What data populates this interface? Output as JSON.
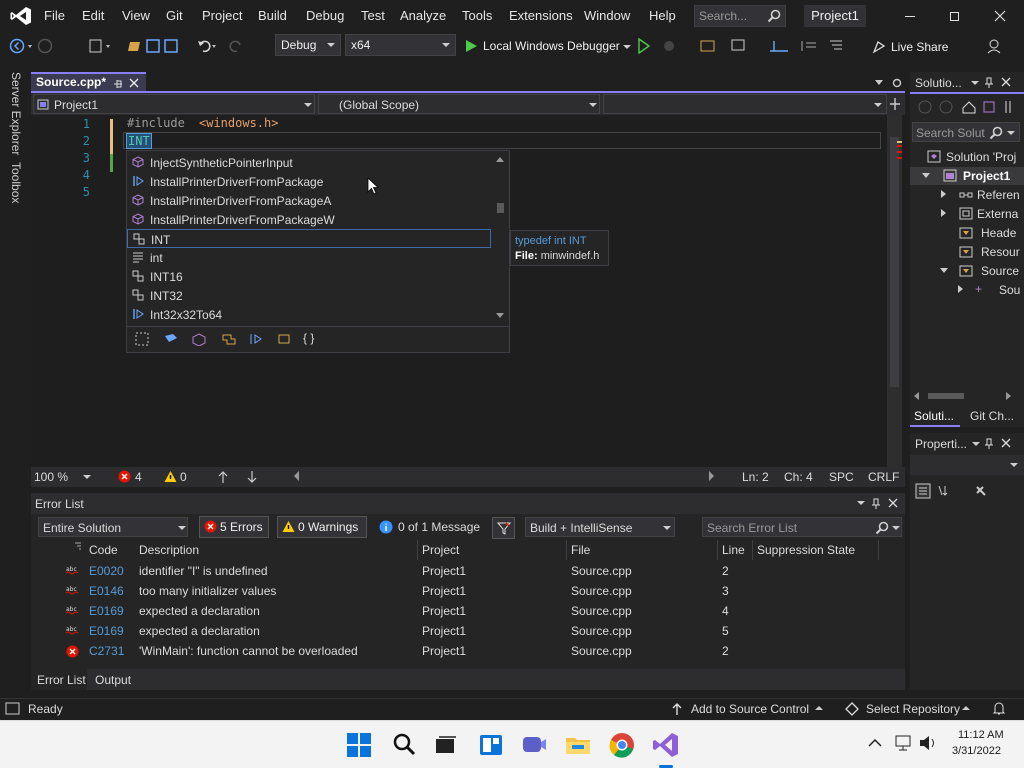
{
  "menu": {
    "items": [
      "File",
      "Edit",
      "View",
      "Git",
      "Project",
      "Build",
      "Debug",
      "Test",
      "Analyze",
      "Tools",
      "Extensions",
      "Window",
      "Help"
    ],
    "search_placeholder": "Search...",
    "project_name": "Project1"
  },
  "toolbar": {
    "config": "Debug",
    "platform": "x64",
    "debugger": "Local Windows Debugger",
    "live_share": "Live Share"
  },
  "left_strip": {
    "server_explorer": "Server Explorer",
    "toolbox": "Toolbox"
  },
  "document": {
    "tab_title": "Source.cpp*",
    "project_dropdown": "Project1",
    "scope_dropdown": "(Global Scope)",
    "line_numbers": [
      "1",
      "2",
      "3",
      "4",
      "5"
    ],
    "code": {
      "line1_keyword": "#include ",
      "line1_header": "<windows.h>",
      "line2_text": "INT"
    },
    "statusbar": {
      "zoom": "100 %",
      "errors": "4",
      "warnings": "0",
      "line": "Ln: 2",
      "col": "Ch: 4",
      "spc": "SPC",
      "crlf": "CRLF"
    }
  },
  "intellisense": {
    "items": [
      {
        "label": "InjectSyntheticPointerInput",
        "icon": "cube-icon"
      },
      {
        "label": "InstallPrinterDriverFromPackage",
        "icon": "function-icon"
      },
      {
        "label": "InstallPrinterDriverFromPackageA",
        "icon": "cube-icon"
      },
      {
        "label": "InstallPrinterDriverFromPackageW",
        "icon": "cube-icon"
      },
      {
        "label": "INT",
        "icon": "typedef-icon"
      },
      {
        "label": "int",
        "icon": "keyword-icon"
      },
      {
        "label": "INT16",
        "icon": "typedef-icon"
      },
      {
        "label": "INT32",
        "icon": "typedef-icon"
      },
      {
        "label": "Int32x32To64",
        "icon": "function-icon"
      }
    ],
    "filter_icons": [
      "macro-icon",
      "class-icon",
      "struct-icon",
      "enum-icon",
      "function-icon",
      "namespace-icon",
      "braces-icon"
    ],
    "braces_label": "{ }",
    "tooltip_line1": "typedef int INT",
    "tooltip_file_label": "File:",
    "tooltip_file": "minwindef.h"
  },
  "error_list": {
    "title": "Error List",
    "scope": "Entire Solution",
    "errors_btn": "5 Errors",
    "warnings_btn": "0 Warnings",
    "messages_btn": "0 of 1 Message",
    "build_filter": "Build + IntelliSense",
    "search_placeholder": "Search Error List",
    "columns": {
      "code": "Code",
      "description": "Description",
      "project": "Project",
      "file": "File",
      "line": "Line",
      "suppression": "Suppression State"
    },
    "rows": [
      {
        "code": "E0020",
        "description": "identifier \"I\" is undefined",
        "project": "Project1",
        "file": "Source.cpp",
        "line": "2",
        "severity": "intellisense"
      },
      {
        "code": "E0146",
        "description": "too many initializer values",
        "project": "Project1",
        "file": "Source.cpp",
        "line": "3",
        "severity": "intellisense"
      },
      {
        "code": "E0169",
        "description": "expected a declaration",
        "project": "Project1",
        "file": "Source.cpp",
        "line": "4",
        "severity": "intellisense"
      },
      {
        "code": "E0169",
        "description": "expected a declaration",
        "project": "Project1",
        "file": "Source.cpp",
        "line": "5",
        "severity": "intellisense"
      },
      {
        "code": "C2731",
        "description": "'WinMain': function cannot be overloaded",
        "project": "Project1",
        "file": "Source.cpp",
        "line": "2",
        "severity": "error"
      }
    ],
    "tabs": [
      "Error List",
      "Output"
    ]
  },
  "solution_explorer": {
    "title": "Solutio...",
    "search_placeholder": "Search Solut",
    "tree": [
      "Solution 'Proj",
      "Project1",
      "Referen",
      "Externa",
      "Heade",
      "Resour",
      "Source",
      "Sou"
    ],
    "tabs": [
      "Soluti...",
      "Git Ch..."
    ]
  },
  "properties": {
    "title": "Properti..."
  },
  "status": {
    "ready": "Ready",
    "add_source_control": "Add to Source Control",
    "select_repo": "Select Repository"
  },
  "taskbar": {
    "time": "11:12 AM",
    "date": "3/31/2022"
  },
  "colors": {
    "accent": "#8a7ef7",
    "error_red": "#e51400",
    "warning_yellow": "#ffcc00",
    "link_blue": "#569cd6"
  }
}
